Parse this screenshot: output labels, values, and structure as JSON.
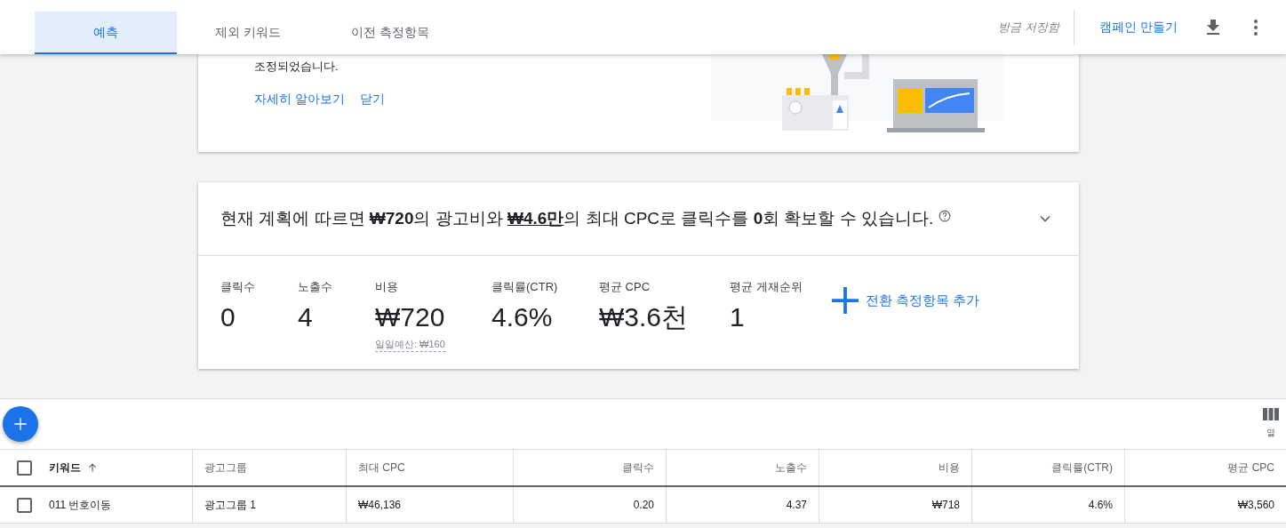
{
  "tabs": [
    {
      "label": "예측",
      "selected": true
    },
    {
      "label": "제외 키워드",
      "selected": false
    },
    {
      "label": "이전 측정항목",
      "selected": false
    }
  ],
  "header": {
    "save_status": "방금 저장함",
    "create_campaign": "캠페인 만들기"
  },
  "info_card": {
    "text_lines": [
      "조정되었습니다."
    ],
    "links": [
      "자세히 알아보기",
      "닫기"
    ]
  },
  "summary": {
    "parts": [
      {
        "kind": "text",
        "text": "현재 계획에 따르면 "
      },
      {
        "kind": "bold",
        "text": "₩720"
      },
      {
        "kind": "text",
        "text": "의 광고비와 "
      },
      {
        "kind": "link",
        "text": "₩4.6만"
      },
      {
        "kind": "text",
        "text": "의 최대 CPC로 클릭수를 "
      },
      {
        "kind": "bold",
        "text": "0"
      },
      {
        "kind": "text",
        "text": "회 확보할 수 있습니다."
      }
    ],
    "expanded": false,
    "metrics": [
      {
        "label": "클릭수",
        "value": "0"
      },
      {
        "label": "노출수",
        "value": "4"
      },
      {
        "label": "비용",
        "value": "₩720",
        "note": "일일예산: ₩160"
      },
      {
        "label": "클릭률(CTR)",
        "value": "4.6%"
      },
      {
        "label": "평균 CPC",
        "value": "₩3.6천"
      },
      {
        "label": "평균 게재순위",
        "value": "1"
      }
    ],
    "add_conversion": "전환 측정항목 추가"
  },
  "table": {
    "columns_label": "열",
    "columns": [
      {
        "label": "키워드",
        "sorted": true
      },
      {
        "label": "광고그룹",
        "sorted": false
      },
      {
        "label": "최대 CPC",
        "sorted": false
      },
      {
        "label": "클릭수",
        "sorted": false
      },
      {
        "label": "노출수",
        "sorted": false
      },
      {
        "label": "비용",
        "sorted": false
      },
      {
        "label": "클릭률(CTR)",
        "sorted": false
      },
      {
        "label": "평균 CPC",
        "sorted": false
      }
    ],
    "header_checked": false,
    "rows": [
      {
        "checked": false,
        "cells": [
          "011 번호이동",
          "광고그룹 1",
          "₩46,136",
          "0.20",
          "4.37",
          "₩718",
          "4.6%",
          "₩3,560"
        ]
      }
    ]
  }
}
